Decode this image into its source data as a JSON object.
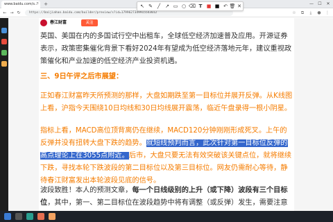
{
  "browser": {
    "tab_title": "www.baidu.com/s...",
    "url": "https://baijiahao.baidu.com/builder/preview/s?id=1799627349915543012"
  },
  "annotation_toolbar": {
    "icons": [
      "pointer-icon",
      "pen-icon",
      "line-icon",
      "arrow-icon",
      "rectangle-icon",
      "circle-icon",
      "eraser-icon",
      "text-icon",
      "color-red",
      "color-black",
      "undo-icon",
      "clear-icon",
      "close-icon"
    ]
  },
  "article": {
    "author": "春江财富",
    "follow_label": "关注",
    "para1": "英国、美国在内的多国试行空中出租车，全球低空经济加速普及应用。开源证券表示，政策密集催化背景下看好2024年有望成为低空经济落地元年，建议重视政策催化和产业加速的低空经济产业投资机遇。",
    "section_title": "三、9日午评之后市展望：",
    "para2": "正如春江财富昨天所预测的那样，大盘如期跌至第一目标位并展开反弹。从K线图上看，沪指今天围绕10日均线和30日均线展开震荡，临近午盘录得一根小阴星。",
    "para3_before": "指标上看，MACD高位顶背离仍在继续，MACD120分钟刚刚形成死叉。上午的反弹并没有扭转大盘下跌的趋势。",
    "para3_highlight": "就短线预判而言，此次针对第一目标位反弹的高点理论上在3055点附近。",
    "para3_after": "后市，大盘只要无法有效突破该关键点位，就将继续下跌，寻找本轮下跌波段的第二目标位以及第三目标位。网友仍需耐心等待，静待春江财富发出本轮波段见底的信号。",
    "para4_start": "波段致胜！本人的预测文章，",
    "para4_emph": "每一个日线级别的上升（或下降）波段有三个目标位",
    "para4_end": "，其中，第一、第二目标位在波段趋势中将有调整（或反弹）发生，需要注意的是，第一"
  },
  "colors": {
    "orange_text": "#f57c00",
    "highlight_bg": "#3366cc",
    "follow_button": "#ff5a36"
  }
}
